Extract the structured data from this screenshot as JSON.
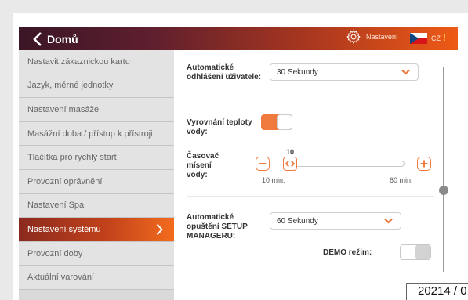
{
  "header": {
    "back_label": "Domů",
    "settings_label": "Nastavení",
    "language": "CZ",
    "alert": "!"
  },
  "sidebar": {
    "items": [
      {
        "label": "Nastavit zákaznickou kartu"
      },
      {
        "label": "Jazyk, měrné jednotky"
      },
      {
        "label": "Nastavení masáže"
      },
      {
        "label": "Masážní doba / přístup k přístroji"
      },
      {
        "label": "Tlačítka pro rychlý start"
      },
      {
        "label": "Provozní oprávnění"
      },
      {
        "label": "Nastavení Spa"
      },
      {
        "label": "Nastavení systému",
        "active": true
      },
      {
        "label": "Provozní doby"
      },
      {
        "label": "Aktuální varování"
      }
    ]
  },
  "settings": {
    "auto_logout": {
      "label": "Automatické odhlášení uživatele:",
      "value": "30 Sekundy"
    },
    "temp_balance": {
      "label": "Vyrovnání teploty vody:",
      "on": true
    },
    "mix_timer": {
      "label": "Časovač mísení vody:",
      "value": "10",
      "min_label": "10 min.",
      "max_label": "60 min.",
      "level": 0
    },
    "setup_exit": {
      "label": "Automatické opuštění SETUP MANAGERU:",
      "value": "60 Sekundy"
    },
    "demo": {
      "label": "DEMO režim:",
      "on": false
    }
  },
  "stamp": "20214 / 0",
  "colors": {
    "accent": "#f07a3d",
    "header_start": "#3a1626",
    "header_end": "#ee5a16"
  },
  "icons": {
    "back": "chevron-left-icon",
    "settings": "gear-icon",
    "flag": "czech-flag-icon",
    "select_arrow": "chevron-down-icon",
    "minus": "minus-icon",
    "plus": "plus-icon",
    "slider": "code-arrows-icon"
  }
}
